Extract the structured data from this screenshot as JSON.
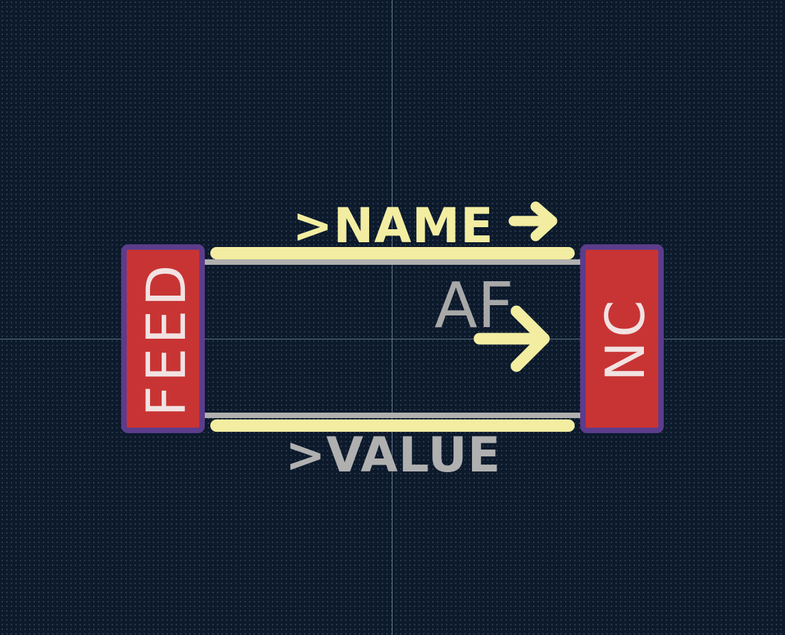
{
  "footprint": {
    "name_label": ">NAME",
    "value_label": ">VALUE",
    "reference_label": "AF",
    "pads": [
      {
        "label": "FEED"
      },
      {
        "label": "NC"
      }
    ]
  },
  "colors": {
    "background": "#0c1a2c",
    "grid_dot": "#3a4a5c",
    "crosshair": "#8aa0b8",
    "pad_fill": "#c83434",
    "pad_outline": "#5c3c8c",
    "pad_text": "#f2e2e2",
    "silkscreen": "#f2eda1",
    "fab": "#b0b0b0",
    "courtyard": "#c9a6c9"
  },
  "icons": [
    "orientation-arrow-icon",
    "antenna-direction-arrow-icon"
  ]
}
